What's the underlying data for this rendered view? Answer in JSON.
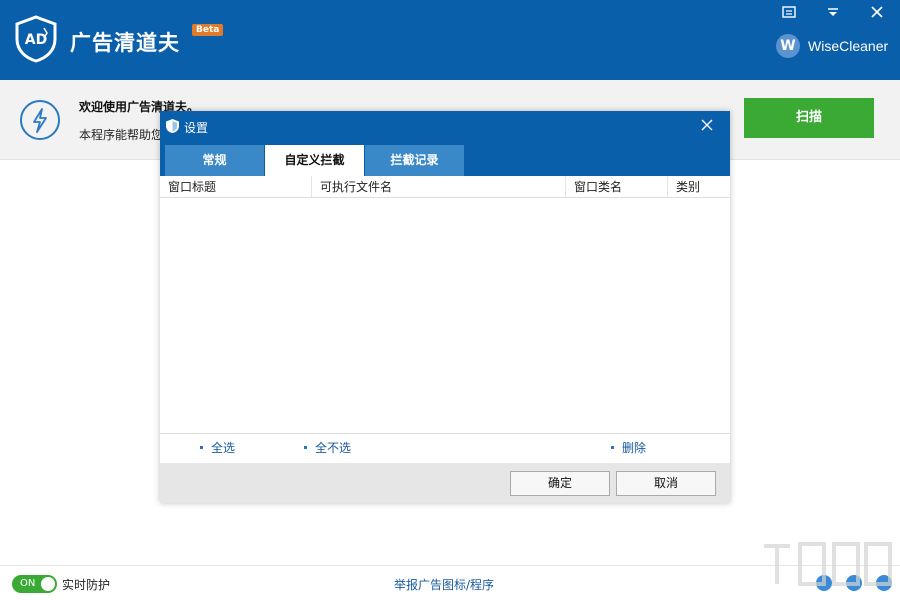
{
  "header": {
    "app_title": "广告清道夫",
    "beta_badge": "Beta",
    "brand_text": "WiseCleaner",
    "brand_logo_letter": "W",
    "window_buttons": [
      "menu-icon",
      "minimize-icon",
      "close-icon"
    ]
  },
  "welcome": {
    "title": "欢迎使用广告清道夫。",
    "description": "本程序能帮助您",
    "scan_button": "扫描"
  },
  "dialog": {
    "title": "设置",
    "tabs": [
      {
        "label": "常规",
        "active": false
      },
      {
        "label": "自定义拦截",
        "active": true
      },
      {
        "label": "拦截记录",
        "active": false
      }
    ],
    "columns": [
      "窗口标题",
      "可执行文件名",
      "窗口类名",
      "类别"
    ],
    "rows": [],
    "links": {
      "select_all": "全选",
      "select_none": "全不选",
      "delete": "删除"
    },
    "buttons": {
      "ok": "确定",
      "cancel": "取消"
    }
  },
  "bottom": {
    "toggle_state": "ON",
    "protection_label": "实时防护",
    "report_link": "举报广告图标/程序"
  },
  "colors": {
    "primary": "#0a5faa",
    "tab_inactive": "#3b88c8",
    "accent_green": "#3aaa35"
  }
}
